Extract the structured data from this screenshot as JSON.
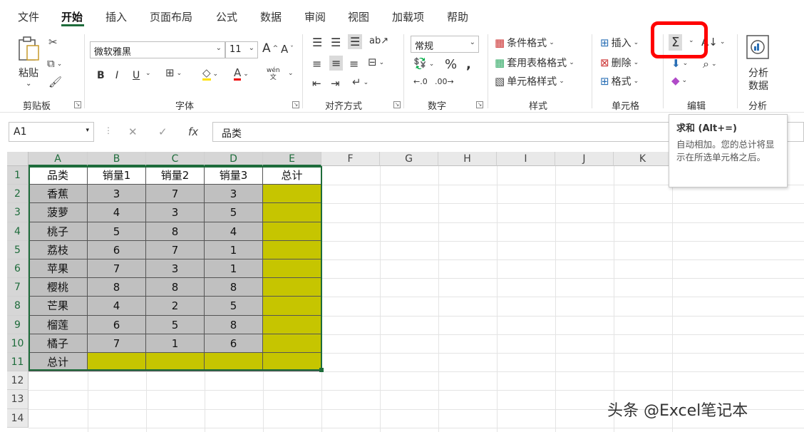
{
  "menu": {
    "tabs": [
      {
        "label": "文件",
        "active": false
      },
      {
        "label": "开始",
        "active": true
      },
      {
        "label": "插入",
        "active": false
      },
      {
        "label": "页面布局",
        "active": false
      },
      {
        "label": "公式",
        "active": false
      },
      {
        "label": "数据",
        "active": false
      },
      {
        "label": "审阅",
        "active": false
      },
      {
        "label": "视图",
        "active": false
      },
      {
        "label": "加载项",
        "active": false
      },
      {
        "label": "帮助",
        "active": false
      }
    ]
  },
  "ribbon": {
    "clipboard": {
      "group_label": "剪贴板",
      "paste_label": "粘贴"
    },
    "font": {
      "group_label": "字体",
      "font_name": "微软雅黑",
      "font_size": "11",
      "bold": "B",
      "italic": "I",
      "underline": "U",
      "phonetic_top": "wén",
      "phonetic_bottom": "文"
    },
    "alignment": {
      "group_label": "对齐方式"
    },
    "number": {
      "group_label": "数字",
      "format": "常规"
    },
    "styles": {
      "group_label": "样式",
      "conditional": "条件格式",
      "table_format": "套用表格格式",
      "cell_styles": "单元格样式"
    },
    "cells": {
      "group_label": "单元格",
      "insert": "插入",
      "delete": "删除",
      "format": "格式"
    },
    "editing": {
      "group_label": "编辑",
      "sum_symbol": "Σ"
    },
    "analysis": {
      "group_label": "分析",
      "button_line1": "分析",
      "button_line2": "数据"
    }
  },
  "formula_bar": {
    "name_box": "A1",
    "content": "品类",
    "fx": "fx"
  },
  "tooltip": {
    "title": "求和 (Alt+=)",
    "description": "自动相加。您的总计将显示在所选单元格之后。"
  },
  "sheet": {
    "columns": [
      "A",
      "B",
      "C",
      "D",
      "E",
      "F",
      "G",
      "H",
      "I",
      "J",
      "K"
    ],
    "rows": [
      "1",
      "2",
      "3",
      "4",
      "5",
      "6",
      "7",
      "8",
      "9",
      "10",
      "11",
      "12",
      "13",
      "14"
    ],
    "header": [
      "品类",
      "销量1",
      "销量2",
      "销量3",
      "总计"
    ],
    "data": [
      [
        "香蕉",
        "3",
        "7",
        "3"
      ],
      [
        "菠萝",
        "4",
        "3",
        "5"
      ],
      [
        "桃子",
        "5",
        "8",
        "4"
      ],
      [
        "荔枝",
        "6",
        "7",
        "1"
      ],
      [
        "苹果",
        "7",
        "3",
        "1"
      ],
      [
        "樱桃",
        "8",
        "8",
        "8"
      ],
      [
        "芒果",
        "4",
        "2",
        "5"
      ],
      [
        "榴莲",
        "6",
        "5",
        "8"
      ],
      [
        "橘子",
        "7",
        "1",
        "6"
      ]
    ],
    "total_label": "总计",
    "colors": {
      "header_bg": "#ffffff",
      "data_bg": "#c0c0c0",
      "total_bg": "#c6c500",
      "selection": "#1e6c3b"
    }
  },
  "watermark": "头条 @Excel笔记本",
  "highlight_color": "#ff0000"
}
